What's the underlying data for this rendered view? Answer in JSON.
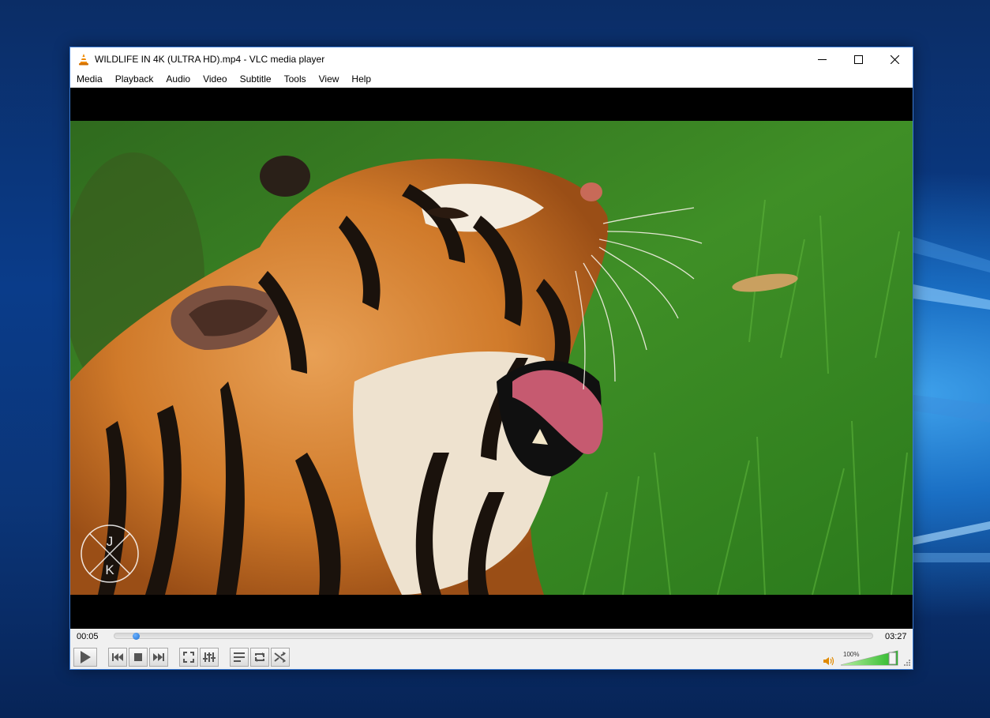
{
  "window": {
    "title": "WILDLIFE IN 4K (ULTRA HD).mp4 - VLC media player"
  },
  "menu": [
    "Media",
    "Playback",
    "Audio",
    "Video",
    "Subtitle",
    "Tools",
    "View",
    "Help"
  ],
  "video": {
    "watermark_letters": [
      "J",
      "K"
    ]
  },
  "player": {
    "elapsed": "00:05",
    "total": "03:27",
    "progress_fraction": 0.024,
    "volume_label": "100%",
    "volume_fraction": 1.0
  },
  "icons": {
    "app": "vlc-cone-icon",
    "minimize": "minimize-icon",
    "maximize": "maximize-icon",
    "close": "close-icon",
    "play": "play-icon",
    "previous": "previous-icon",
    "stop": "stop-icon",
    "next": "next-icon",
    "fullscreen": "fullscreen-icon",
    "extended": "extended-settings-icon",
    "playlist": "playlist-icon",
    "loop": "loop-icon",
    "shuffle": "shuffle-icon",
    "volume": "speaker-icon"
  },
  "colors": {
    "accent": "#1e6fd0",
    "volume_fill": "#3fc23f",
    "vlc_orange": "#f08a00"
  }
}
